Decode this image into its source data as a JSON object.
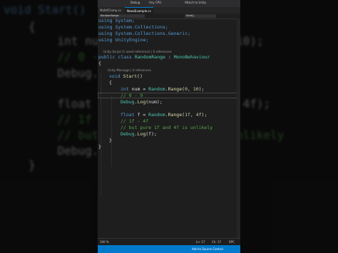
{
  "background": {
    "lines": [
      {
        "text": "void Start()"
      },
      {
        "text": "{"
      },
      {
        "text": "    int num = Random.Range(0, 10);"
      },
      {
        "text": "    // 0 - 9"
      },
      {
        "text": "    Debug.Log(num);"
      },
      {
        "text": "    float f = Random.Range(1f, 4f);"
      },
      {
        "text": "    // 1f - 4f"
      },
      {
        "text": "    // but pure 1f and 4f is unlikely"
      },
      {
        "text": "    Debug.Log(f);"
      },
      {
        "text": "}"
      }
    ]
  },
  "window": {
    "title_items": [
      "Debug",
      "Any CPU",
      "Attach to Unity"
    ],
    "tabs": [
      "MathfClamp.cs",
      "NewsExample.cs"
    ],
    "nav": {
      "left": "RandomRange",
      "right": "Start()"
    }
  },
  "code": {
    "usings": [
      "using System;",
      "using System.Collections;",
      "using System.Collections.Generic;",
      "using UnityEngine;"
    ],
    "class_hint": "Unity Script (1 asset reference) | 0 references",
    "class_decl": {
      "kw": "public class",
      "name": "RandomRange",
      "sep": " : ",
      "base": "MonoBehaviour"
    },
    "open_brace": "{",
    "method_hint": "Unity Message | 0 references",
    "method_decl": {
      "kw": "void",
      "name": "Start",
      "rest": "()"
    },
    "method_open": "{",
    "line_num": {
      "kw": "int",
      "pre": " num = ",
      "cls": "Random",
      "dot": ".",
      "fn": "Range",
      "open": "(",
      "a": "0",
      "comma": ", ",
      "b": "10",
      "close": ");"
    },
    "comment1": "// 0 - 9",
    "log1": {
      "cls": "Debug",
      "dot": ".",
      "fn": "Log",
      "args": "(num);"
    },
    "line_float": {
      "kw": "float",
      "pre": " f = ",
      "cls": "Random",
      "dot": ".",
      "fn": "Range",
      "open": "(",
      "a": "1f",
      "comma": ", ",
      "b": "4f",
      "close": ");"
    },
    "comment2": "// 1f - 4f",
    "comment3": "// but pure 1f and 4f is unlikely",
    "log2": {
      "cls": "Debug",
      "dot": ".",
      "fn": "Log",
      "args": "(f);"
    },
    "method_close": "}",
    "class_close": "}"
  },
  "status": {
    "zoom": "100 %",
    "position": "Ln: 17",
    "column": "Ch: 17",
    "spc": "SPC",
    "bottom_right": "Add to Source Control"
  },
  "colors": {
    "keyword": "#569cd6",
    "type": "#4ec9b0",
    "method": "#dcdcaa",
    "comment": "#57a64a",
    "number": "#b5cea8",
    "statusbar": "#007acc"
  }
}
